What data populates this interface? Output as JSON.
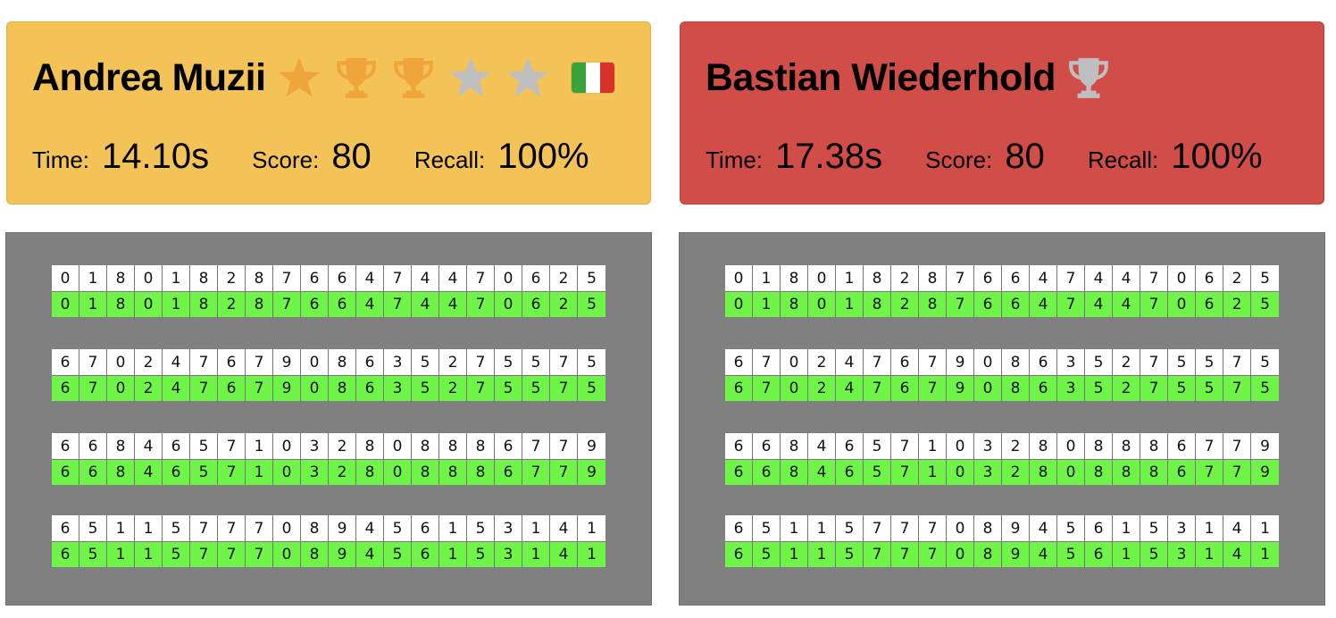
{
  "players": [
    {
      "name": "Andrea Muzii",
      "card_color": "#f3c358",
      "badges": [
        "star-gold",
        "trophy-gold",
        "trophy-gold",
        "star-gray",
        "star-gray"
      ],
      "flag": [
        "#3aa33a",
        "#ffffff",
        "#d8322b"
      ],
      "time_label": "Time:",
      "time_value": "14.10s",
      "score_label": "Score:",
      "score_value": "80",
      "recall_label": "Recall:",
      "recall_value": "100%"
    },
    {
      "name": "Bastian Wiederhold",
      "card_color": "#d14d48",
      "badges": [
        "trophy-gray"
      ],
      "flag": null,
      "time_label": "Time:",
      "time_value": "17.38s",
      "score_label": "Score:",
      "score_value": "80",
      "recall_label": "Recall:",
      "recall_value": "100%"
    }
  ],
  "rows": [
    "01801828766474470625",
    "67024767908635275575",
    "66846571032808886779",
    "65115777089456153141"
  ],
  "recall_color": "#6ff548"
}
